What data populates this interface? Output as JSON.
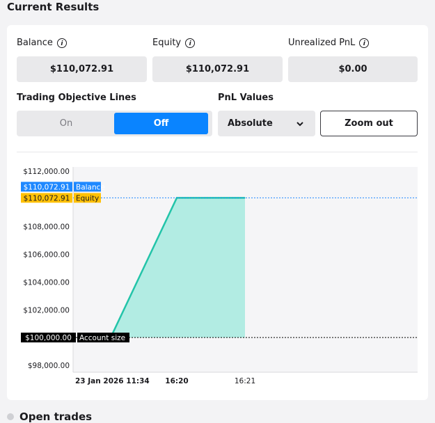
{
  "section_title": "Current Results",
  "metrics": [
    {
      "label": "Balance",
      "value": "$110,072.91",
      "icon": "info-icon"
    },
    {
      "label": "Equity",
      "value": "$110,072.91",
      "icon": "info-icon"
    },
    {
      "label": "Unrealized PnL",
      "value": "$0.00",
      "icon": "info-icon"
    }
  ],
  "objective_lines": {
    "label": "Trading Objective Lines",
    "options": [
      "On",
      "Off"
    ],
    "selected": "Off"
  },
  "pnl_values": {
    "label": "PnL Values",
    "selected": "Absolute",
    "icon": "chevron-down-icon"
  },
  "zoom_button": "Zoom out",
  "colors": {
    "accent": "#0a84ff",
    "balance_tag": "#1e88ff",
    "equity_tag": "#ffc107",
    "series_line": "#23c4a9",
    "series_fill": "#b2ece3",
    "plot_bg": "#f5f5f7"
  },
  "chart_data": {
    "type": "area",
    "y_ticks": [
      "$112,000.00",
      "$108,000.00",
      "$106,000.00",
      "$104,000.00",
      "$102,000.00",
      "$98,000.00"
    ],
    "x_ticks": [
      {
        "label": "23 Jan 2026 11:34",
        "bold": true
      },
      {
        "label": "16:20",
        "bold": true
      },
      {
        "label": "16:21",
        "bold": false
      }
    ],
    "ylim": [
      97500,
      112300
    ],
    "x": [
      0.0,
      1.0,
      2.0
    ],
    "series": [
      {
        "name": "Balance",
        "values": [
          100000,
          110072.91,
          110072.91
        ]
      }
    ],
    "markers": [
      {
        "value_label": "$110,072.91",
        "name": "Balance",
        "value": 110072.91,
        "color": "#1e88ff",
        "text_color": "#ffffff",
        "line": false
      },
      {
        "value_label": "$110,072.91",
        "name": "Equity",
        "value": 110072.91,
        "color": "#ffc107",
        "text_color": "#1b1b1f",
        "line": true,
        "line_color": "#1e88ff"
      },
      {
        "value_label": "$100,000.00",
        "name": "Account size",
        "value": 100000,
        "color": "#000000",
        "text_color": "#ffffff",
        "line": true,
        "line_color": "#000000"
      }
    ]
  },
  "open_trades": {
    "label": "Open trades"
  }
}
